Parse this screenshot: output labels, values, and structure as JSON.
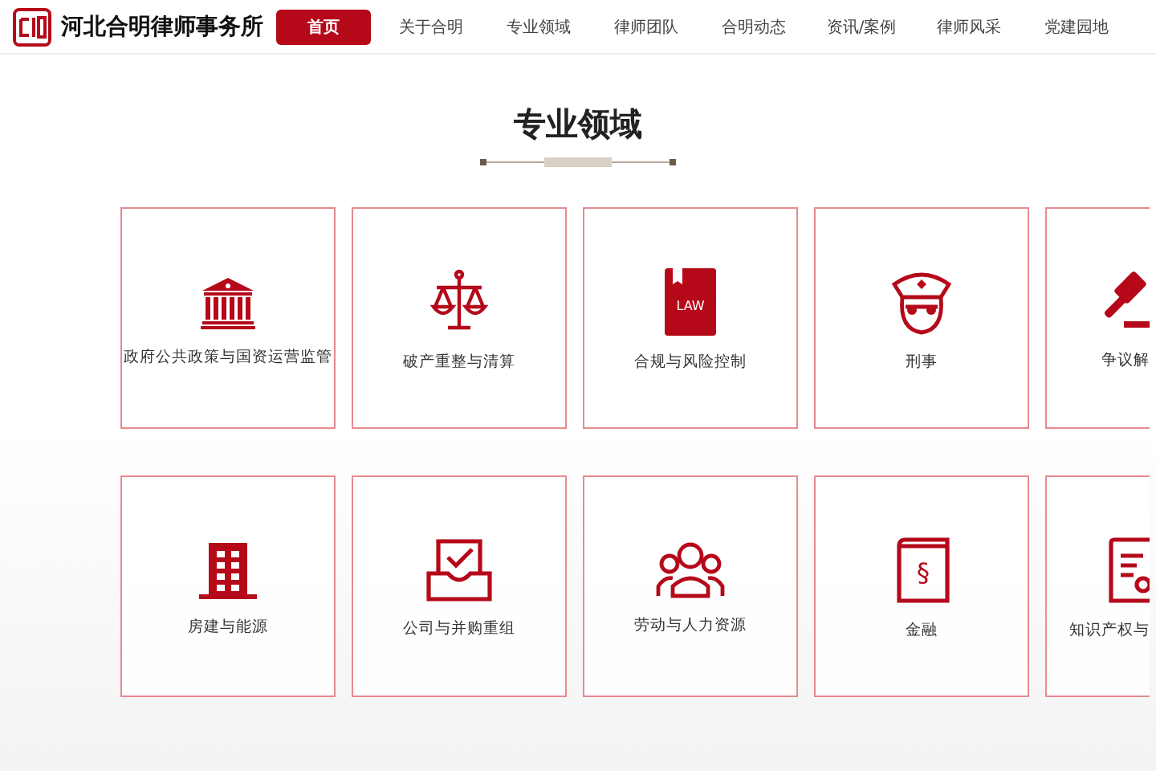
{
  "header": {
    "logo_text": "河北合明律师事务所"
  },
  "nav": [
    {
      "label": "首页",
      "selected": true
    },
    {
      "label": "关于合明",
      "selected": false
    },
    {
      "label": "专业领域",
      "selected": false
    },
    {
      "label": "律师团队",
      "selected": false
    },
    {
      "label": "合明动态",
      "selected": false
    },
    {
      "label": "资讯/案例",
      "selected": false
    },
    {
      "label": "律师风采",
      "selected": false
    },
    {
      "label": "党建园地",
      "selected": false
    }
  ],
  "section": {
    "title": "专业领域"
  },
  "practice_areas": [
    [
      {
        "label": "政府公共政策与国资运营监管"
      },
      {
        "label": "破产重整与清算"
      },
      {
        "label": "合规与风险控制",
        "icon_text": "LAW"
      },
      {
        "label": "刑事"
      },
      {
        "label": "争议解"
      }
    ],
    [
      {
        "label": "房建与能源"
      },
      {
        "label": "公司与并购重组"
      },
      {
        "label": "劳动与人力资源"
      },
      {
        "label": "金融",
        "icon_text": "§"
      },
      {
        "label": "知识产权与"
      }
    ]
  ]
}
